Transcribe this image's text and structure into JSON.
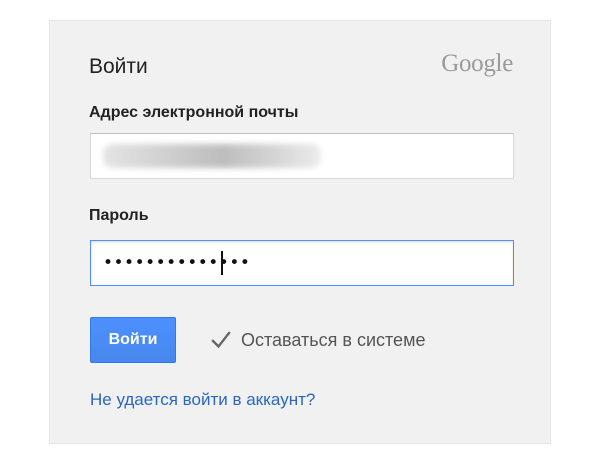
{
  "header": {
    "title": "Войти",
    "logo_text": "Google"
  },
  "form": {
    "email_label": "Адрес электронной почты",
    "email_value": "",
    "password_label": "Пароль",
    "password_value": "••••••••••••••",
    "signin_label": "Войти",
    "remember_label": "Оставаться в системе",
    "remember_checked": true,
    "help_link": "Не удается войти в аккаунт?"
  },
  "colors": {
    "accent": "#4d90fe",
    "link": "#2a66c2",
    "card_bg": "#f1f1f1"
  }
}
